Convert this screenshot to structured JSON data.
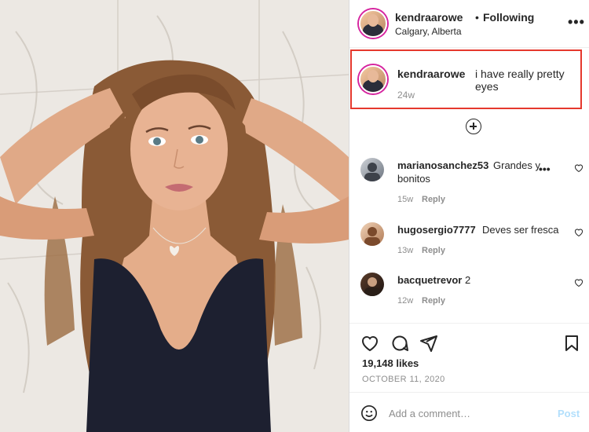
{
  "post": {
    "author": "kendraarowe",
    "follow_separator": "•",
    "follow_status": "Following",
    "location": "Calgary, Alberta",
    "more_icon": "more-horizontal-icon",
    "more_label": "•••"
  },
  "caption": {
    "username": "kendraarowe",
    "text": "i have really pretty eyes",
    "time": "24w",
    "highlight_color": "#e5382d"
  },
  "load_more_icon": "plus-circle-icon",
  "comments": [
    {
      "username": "marianosanchez53",
      "text_line1": "Grandes y",
      "text_line2": "bonitos",
      "time": "15w",
      "reply": "Reply",
      "more": "•••"
    },
    {
      "username": "hugosergio7777",
      "text_line1": "Deves ser fresca",
      "time": "13w",
      "reply": "Reply"
    },
    {
      "username": "bacquetrevor",
      "text_line1": "2",
      "time": "12w",
      "reply": "Reply"
    }
  ],
  "actions": {
    "like_icon": "heart-icon",
    "comment_icon": "comment-icon",
    "share_icon": "send-icon",
    "save_icon": "bookmark-icon",
    "likes": "19,148 likes",
    "date": "OCTOBER 11, 2020"
  },
  "add_comment": {
    "emoji_icon": "smiley-icon",
    "placeholder": "Add a comment…",
    "post_label": "Post",
    "post_color": "#b2dffc"
  }
}
